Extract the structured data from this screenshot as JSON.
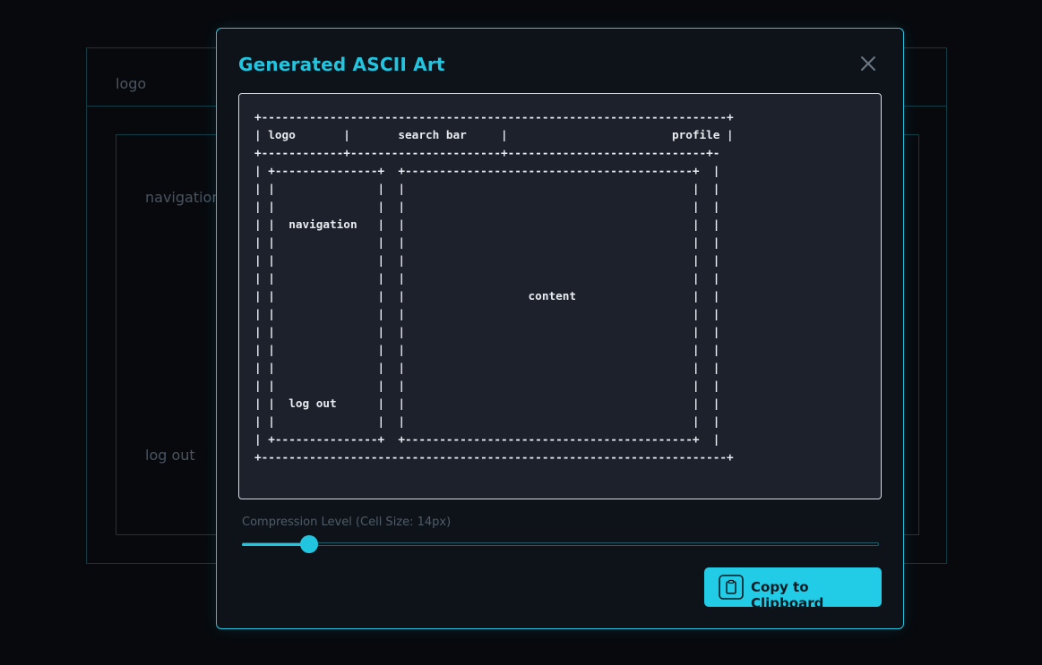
{
  "background": {
    "logo": "logo",
    "navigation": "navigation",
    "logout": "log out"
  },
  "modal": {
    "title": "Generated ASCII Art",
    "close_icon": "close-icon",
    "ascii_art": "+--------------------------------------------------------------------+\n| logo       |       search bar     |                        profile |\n+------------+----------------------+-----------------------------+-\n| +---------------+  +------------------------------------------+  |\n| |               |  |                                          |  |\n| |               |  |                                          |  |\n| |  navigation   |  |                                          |  |\n| |               |  |                                          |  |\n| |               |  |                                          |  |\n| |               |  |                                          |  |\n| |               |  |                  content                 |  |\n| |               |  |                                          |  |\n| |               |  |                                          |  |\n| |               |  |                                          |  |\n| |               |  |                                          |  |\n| |               |  |                                          |  |\n| |  log out      |  |                                          |  |\n| |               |  |                                          |  |\n| +---------------+  +------------------------------------------+  |\n+--------------------------------------------------------------------+",
    "compression_label": "Compression Level (Cell Size: 14px)",
    "compression_fraction": 0.106,
    "copy_button_label": "Copy to Clipboard",
    "copy_icon": "clipboard-icon"
  },
  "colors": {
    "accent": "#22c5e0",
    "modal_bg": "#0e131a",
    "page_bg": "#07090d"
  }
}
